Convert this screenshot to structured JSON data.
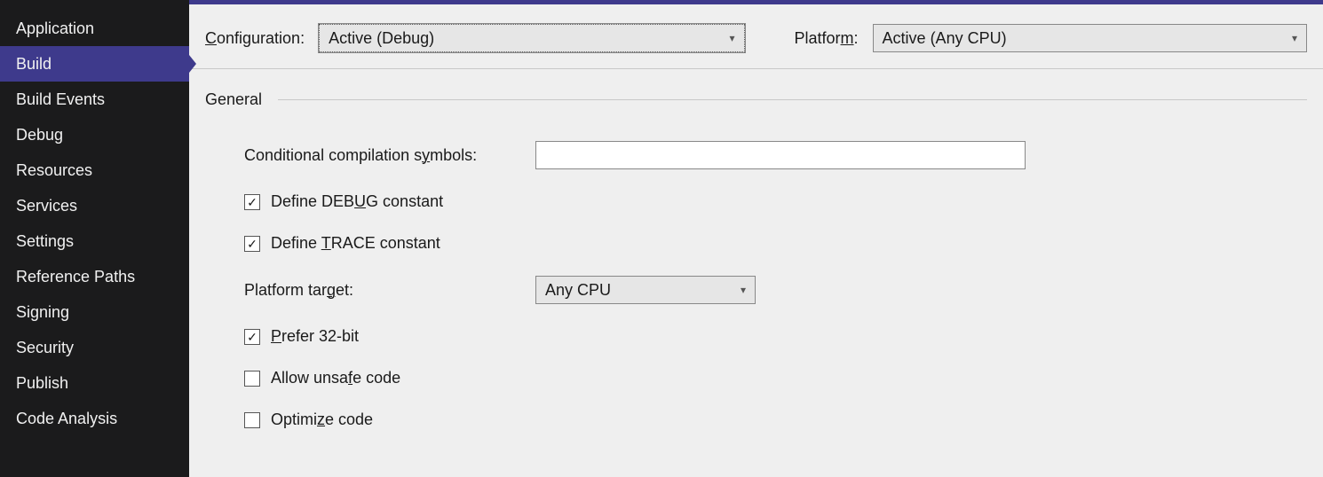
{
  "sidebar": {
    "items": [
      {
        "label": "Application"
      },
      {
        "label": "Build"
      },
      {
        "label": "Build Events"
      },
      {
        "label": "Debug"
      },
      {
        "label": "Resources"
      },
      {
        "label": "Services"
      },
      {
        "label": "Settings"
      },
      {
        "label": "Reference Paths"
      },
      {
        "label": "Signing"
      },
      {
        "label": "Security"
      },
      {
        "label": "Publish"
      },
      {
        "label": "Code Analysis"
      }
    ],
    "active_index": 1
  },
  "config_bar": {
    "configuration_label_prefix": "C",
    "configuration_label_suffix": "onfiguration:",
    "configuration_value": "Active (Debug)",
    "platform_label_prefix": "Platfor",
    "platform_label_underline": "m",
    "platform_label_suffix": ":",
    "platform_value": "Active (Any CPU)"
  },
  "general": {
    "title": "General",
    "conditional_symbols": {
      "label_prefix": "Conditional compilation s",
      "label_underline": "y",
      "label_suffix": "mbols:",
      "value": ""
    },
    "define_debug": {
      "checked": true,
      "label_prefix": "Define DEB",
      "label_underline": "U",
      "label_suffix": "G constant"
    },
    "define_trace": {
      "checked": true,
      "label_prefix": "Define ",
      "label_underline": "T",
      "label_suffix": "RACE constant"
    },
    "platform_target": {
      "label_prefix": "Platform tar",
      "label_underline": "g",
      "label_suffix": "et:",
      "value": "Any CPU"
    },
    "prefer_32bit": {
      "checked": true,
      "label_underline": "P",
      "label_suffix": "refer 32-bit"
    },
    "allow_unsafe": {
      "checked": false,
      "label_prefix": "Allow unsa",
      "label_underline": "f",
      "label_suffix": "e code"
    },
    "optimize_code": {
      "checked": false,
      "label_prefix": "Optimi",
      "label_underline": "z",
      "label_suffix": "e code"
    }
  }
}
